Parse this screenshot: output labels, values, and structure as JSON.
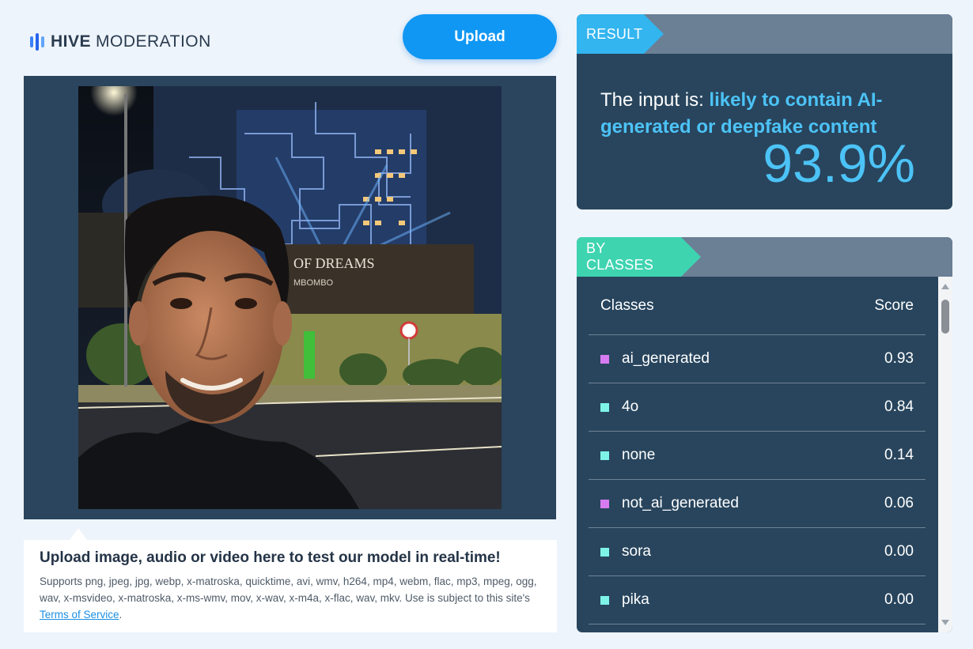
{
  "brand": {
    "strong": "HIVE",
    "rest": "MODERATION"
  },
  "upload_button": "Upload",
  "upload_info": {
    "title": "Upload image, audio or video here to test our model in real-time!",
    "supports": "Supports png, jpeg, jpg, webp, x-matroska, quicktime, avi, wmv, h264, mp4, webm, flac, mp3, mpeg, ogg, wav, x-msvideo, x-matroska, x-ms-wmv, mov, x-wav, x-m4a, x-flac, wav, mkv. Use is subject to this site's",
    "tos_link": "Terms of Service",
    "tos_after": "."
  },
  "preview": {
    "sign_text": "OF DREAMS",
    "sign_subtext": "MBOMBO"
  },
  "result": {
    "tag": "RESULT",
    "prefix": "The input is: ",
    "verdict": "likely to contain AI-generated or deepfake content",
    "percent": "93.9%"
  },
  "by_classes": {
    "tag": "BY CLASSES",
    "col_class": "Classes",
    "col_score": "Score",
    "rows": [
      {
        "name": "ai_generated",
        "score": "0.93",
        "color": "#d77cf0"
      },
      {
        "name": "4o",
        "score": "0.84",
        "color": "#7ef4e8"
      },
      {
        "name": "none",
        "score": "0.14",
        "color": "#7ef4e8"
      },
      {
        "name": "not_ai_generated",
        "score": "0.06",
        "color": "#d77cf0"
      },
      {
        "name": "sora",
        "score": "0.00",
        "color": "#7ef4e8"
      },
      {
        "name": "pika",
        "score": "0.00",
        "color": "#7ef4e8"
      }
    ]
  },
  "colors": {
    "accent_blue": "#1097f3",
    "result_tag": "#33b5ef",
    "classes_tag": "#3ed4b0",
    "panel_bg": "#28455d"
  }
}
